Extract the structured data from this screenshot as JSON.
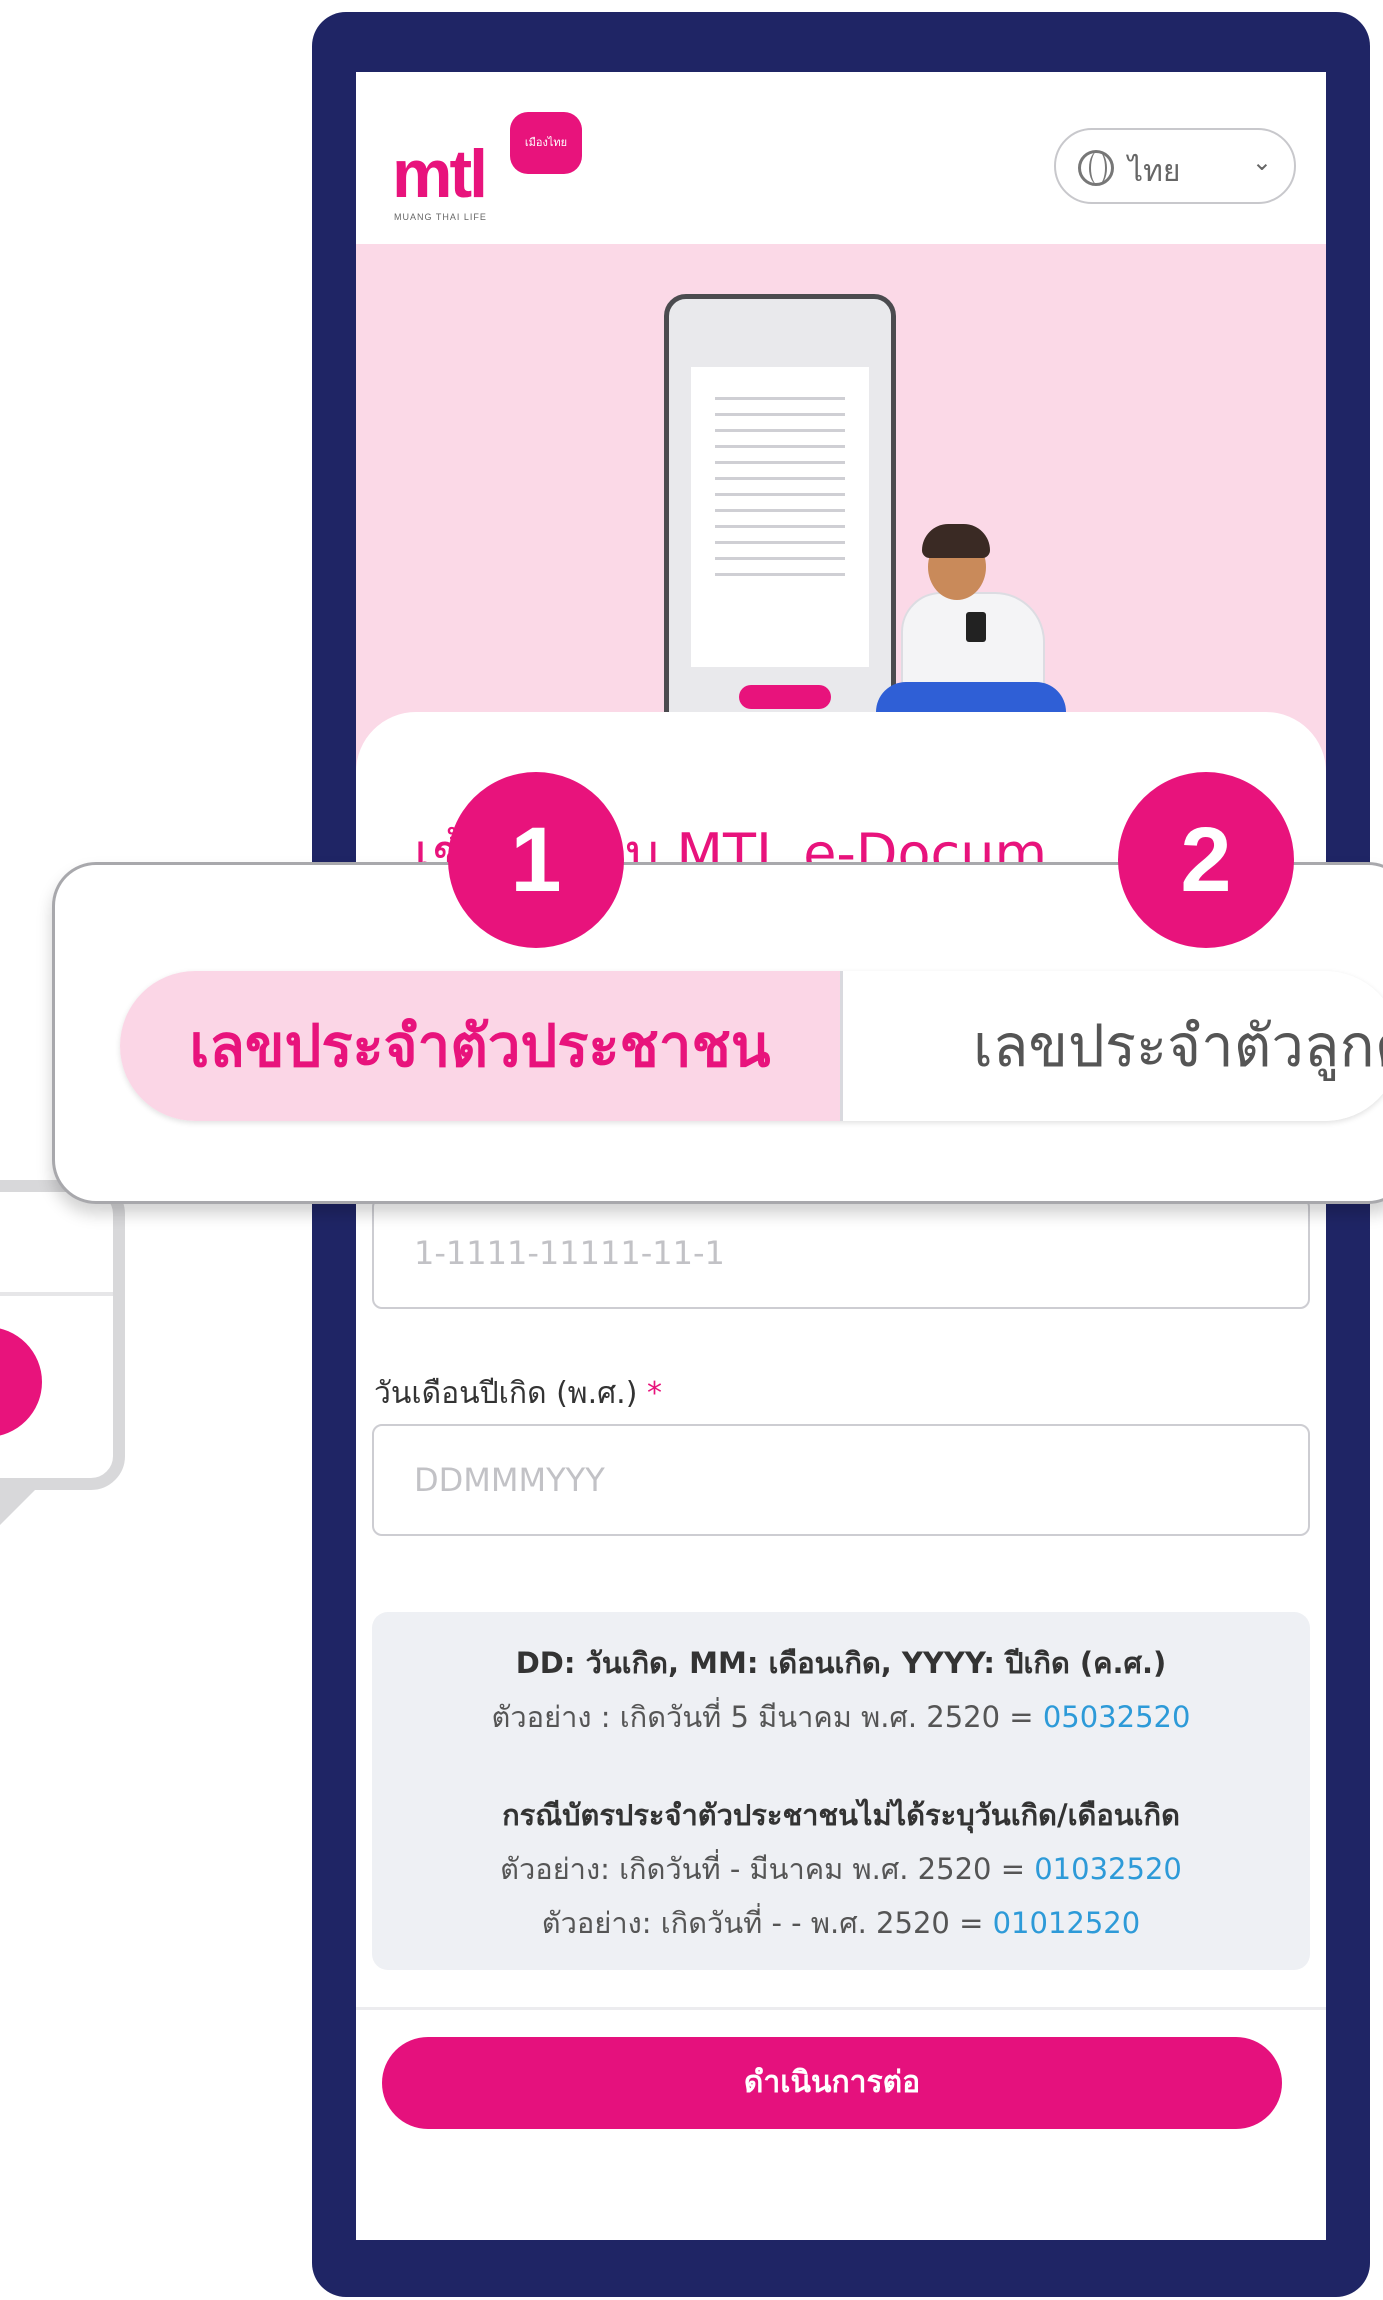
{
  "header": {
    "logo_text": "mtl",
    "logo_tag": "เมืองไทย",
    "logo_subtitle": "MUANG THAI LIFE",
    "language": "ไทย"
  },
  "page": {
    "partial_title": "เข้าสู่ระบบ MTL e-Docum"
  },
  "tabs": [
    {
      "label": "เลขประจำตัวประชาชน",
      "active": true
    },
    {
      "label": "เลขประจำตัวลูกค้า",
      "active": false
    }
  ],
  "badges": [
    "1",
    "2"
  ],
  "form": {
    "id_placeholder": "1-1111-11111-11-1",
    "dob_label": "วันเดือนปีเกิด (พ.ศ.)",
    "dob_required_mark": "*",
    "dob_placeholder": "DDMMMYYY"
  },
  "info": {
    "line1": "DD: วันเกิด, MM: เดือนเกิด, YYYY: ปีเกิด (ค.ศ.)",
    "line2_text": "ตัวอย่าง : เกิดวันที่ 5 มีนาคม พ.ศ. 2520 = ",
    "line2_value": "05032520",
    "line3": "กรณีบัตรประจำตัวประชาชนไม่ได้ระบุวันเกิด/เดือนเกิด",
    "line4_text": "ตัวอย่าง: เกิดวันที่ - มีนาคม พ.ศ. 2520 = ",
    "line4_value": "01032520",
    "line5_text": "ตัวอย่าง: เกิดวันที่ - - พ.ศ. 2520 = ",
    "line5_value": "01012520"
  },
  "cta_label": "ดำเนินการต่อ",
  "colors": {
    "brand": "#e8137c",
    "frame": "#1f2565",
    "hero_bg": "#fbd9e7",
    "link": "#2d9ad8"
  }
}
